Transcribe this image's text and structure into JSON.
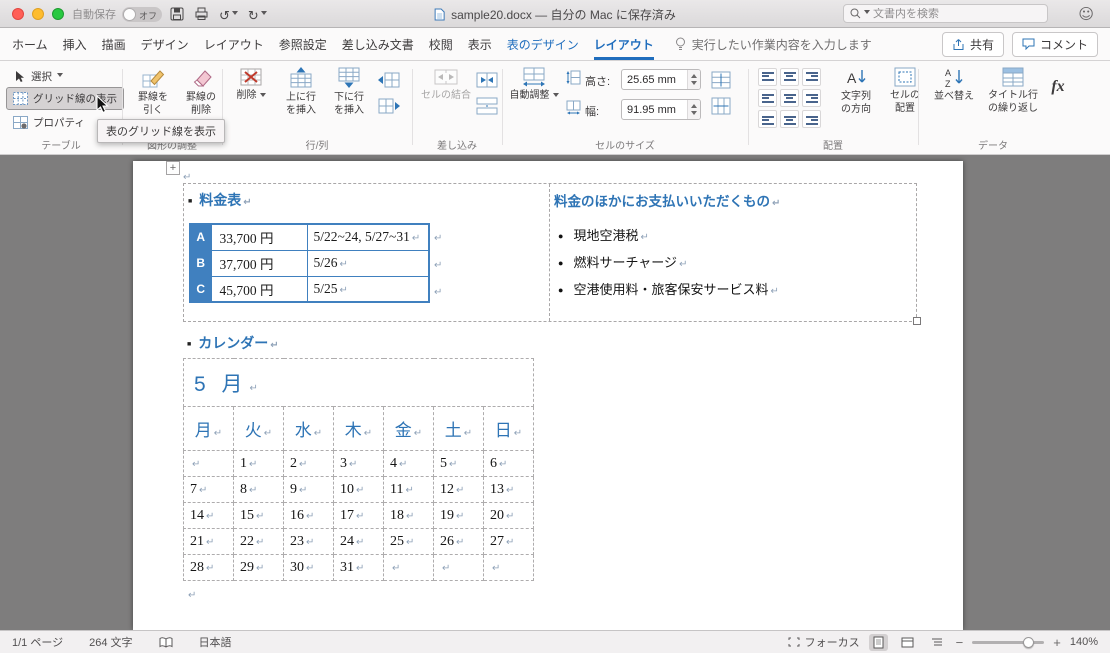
{
  "titlebar": {
    "autosave_label": "自動保存",
    "autosave_state": "オフ",
    "doc_title": "sample20.docx — 自分の Mac に保存済み",
    "search_placeholder": "文書内を検索"
  },
  "tabs": {
    "items": [
      {
        "label": "ホーム"
      },
      {
        "label": "挿入"
      },
      {
        "label": "描画"
      },
      {
        "label": "デザイン"
      },
      {
        "label": "レイアウト"
      },
      {
        "label": "参照設定"
      },
      {
        "label": "差し込み文書"
      },
      {
        "label": "校閲"
      },
      {
        "label": "表示"
      },
      {
        "label": "表のデザイン"
      },
      {
        "label": "レイアウト"
      }
    ],
    "tell_me": "実行したい作業内容を入力します",
    "share_label": "共有",
    "comments_label": "コメント"
  },
  "ribbon": {
    "table_group": {
      "select": "選択",
      "view_gridlines": "グリッド線の表示",
      "properties": "プロパティ",
      "group_label": "テーブル"
    },
    "draw_group": {
      "draw_table": "罫線を\n引く",
      "eraser": "罫線の\n削除",
      "group_label": "図形の調整"
    },
    "rows_group": {
      "delete": "削除",
      "insert_above": "上に行\nを挿入",
      "insert_below": "下に行\nを挿入",
      "group_label": "行/列"
    },
    "merge_group": {
      "merge_cells": "セルの結合",
      "group_label": "差し込み"
    },
    "size_group": {
      "autofit": "自動調整",
      "height_label": "高さ:",
      "height_value": "25.65 mm",
      "width_label": "幅:",
      "width_value": "91.95 mm",
      "group_label": "セルのサイズ"
    },
    "align_group": {
      "text_direction": "文字列\nの方向",
      "cell_margins": "セルの\n配置",
      "group_label": "配置"
    },
    "data_group": {
      "sort": "並べ替え",
      "repeat_header": "タイトル行\nの繰り返し",
      "formula": "fx",
      "group_label": "データ"
    }
  },
  "tooltip": "表のグリッド線を表示",
  "document": {
    "price_table": {
      "heading": "料金表",
      "rows": [
        {
          "key": "A",
          "price": "33,700 円",
          "dates": "5/22~24, 5/27~31"
        },
        {
          "key": "B",
          "price": "37,700 円",
          "dates": "5/26"
        },
        {
          "key": "C",
          "price": "45,700 円",
          "dates": "5/25"
        }
      ]
    },
    "extras": {
      "heading": "料金のほかにお支払いいただくもの",
      "items": [
        "現地空港税",
        "燃料サーチャージ",
        "空港使用料・旅客保安サービス料"
      ]
    },
    "calendar": {
      "heading": "カレンダー",
      "month": "5 月",
      "weekdays": [
        "月",
        "火",
        "水",
        "木",
        "金",
        "土",
        "日"
      ],
      "weeks": [
        [
          "",
          "1",
          "2",
          "3",
          "4",
          "5",
          "6"
        ],
        [
          "7",
          "8",
          "9",
          "10",
          "11",
          "12",
          "13"
        ],
        [
          "14",
          "15",
          "16",
          "17",
          "18",
          "19",
          "20"
        ],
        [
          "21",
          "22",
          "23",
          "24",
          "25",
          "26",
          "27"
        ],
        [
          "28",
          "29",
          "30",
          "31",
          "",
          "",
          ""
        ]
      ]
    }
  },
  "statusbar": {
    "page": "1/1 ページ",
    "words": "264 文字",
    "language": "日本語",
    "focus": "フォーカス",
    "zoom": "140%"
  }
}
